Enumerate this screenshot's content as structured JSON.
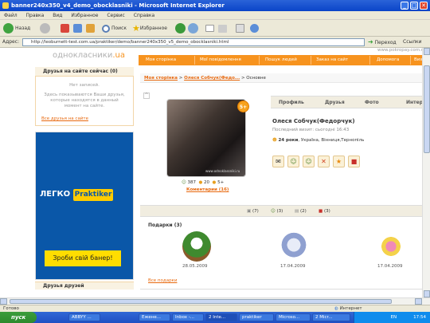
{
  "window": {
    "title": "banner240x350_v4_demo_obocklasniki - Microsoft Internet Explorer",
    "controls": {
      "minimize": "_",
      "maximize": "□",
      "close": "✕"
    }
  },
  "menu": [
    "Файл",
    "Правка",
    "Вид",
    "Избранное",
    "Сервис",
    "Справка"
  ],
  "toolbar": {
    "back": "Назад",
    "search": "Поиск",
    "favorites": "Избранное"
  },
  "address": {
    "label": "Адрес:",
    "url": "http://leoburnett-test.com.ua/praktiker/demo/banner240x350_v5_demo_obocklasniki.html",
    "go": "Переход",
    "links": "Ссылки"
  },
  "site": {
    "logo_main": "однокласники",
    "logo_tld": ".ua",
    "corner_text": "www.pokropay.com.ua",
    "nav": [
      "Моя сторінка",
      "Мої повідомлення",
      "Пошук людей",
      "Заказ на сайт",
      "Допомога",
      "Вихід"
    ],
    "left_box": {
      "title": "Друзья на сайте сейчас (0)",
      "empty": "Нет записей.",
      "text": "Здесь показываются Ваши друзья, которые находятся в данный момент на сайте.",
      "link": "Все друзья на сайте"
    },
    "banner": {
      "brand_prefix": "ЛЕГКО",
      "brand": "Praktiker",
      "cta": "Зроби свій банер!"
    },
    "left_footer": "Друзья друзей",
    "breadcrumb": {
      "home": "Моя сторінка",
      "profile": "Олеся Собчук(Федо...",
      "current": "Основне",
      "sep": ">"
    },
    "tabs": [
      "Профиль",
      "Друзья",
      "Фото",
      "Интер"
    ],
    "profile": {
      "name": "Олеся Собчук(Федорчук)",
      "last_visit": "Последний визит: сьогодні 16:43",
      "age": "24 роки",
      "location": ", Україна, Вінниця,Тернопіль",
      "photo_caption": "www.odnoklassniki.ru",
      "rating_badge": "5+",
      "stats": {
        "likes": "387",
        "coins": "20",
        "grade": "5+"
      },
      "comments": "Коментарии (16)"
    },
    "counters": [
      {
        "icon": "photo",
        "value": "(7)"
      },
      {
        "icon": "people",
        "value": "(3)"
      },
      {
        "icon": "message",
        "value": "(2)"
      },
      {
        "icon": "gift",
        "value": "(3)"
      }
    ],
    "gifts": {
      "title": "Подарки (3)",
      "items": [
        {
          "name": "flower-pot",
          "date": "28.05.2009"
        },
        {
          "name": "bouquet",
          "date": "17.04.2009"
        },
        {
          "name": "cocktails",
          "date": "17.04.2009"
        }
      ],
      "all_link": "Все подарки"
    }
  },
  "status": {
    "left": "Готово",
    "zone": "Интернет"
  },
  "taskbar": {
    "start": "пуск",
    "tasks": [
      "ABBYY ...",
      "Ежене...",
      "Inbox -...",
      "2 Inte...",
      "praktiker",
      "Microso...",
      "2 Micr..."
    ],
    "lang": "EN",
    "time": "17:54"
  },
  "colors": {
    "accent": "#f7931e",
    "banner_blue": "#0a57a8",
    "banner_yellow": "#ffdd00",
    "title_blue": "#0a44c8"
  }
}
